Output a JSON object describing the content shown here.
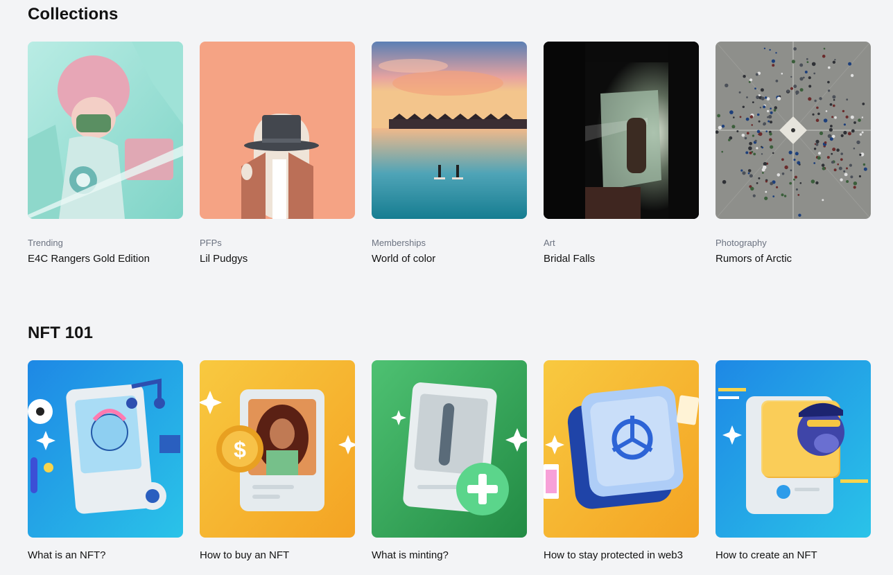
{
  "collections": {
    "title": "Collections",
    "items": [
      {
        "category": "Trending",
        "name": "E4C Rangers Gold Edition",
        "image": "anime-ranger-artwork"
      },
      {
        "category": "PFPs",
        "name": "Lil Pudgys",
        "image": "penguin-top-hat-artwork"
      },
      {
        "category": "Memberships",
        "name": "World of color",
        "image": "sunset-lagoon-photo"
      },
      {
        "category": "Art",
        "name": "Bridal Falls",
        "image": "dark-window-photo"
      },
      {
        "category": "Photography",
        "name": "Rumors of Arctic",
        "image": "aerial-crowd-photo"
      }
    ]
  },
  "nft101": {
    "title": "NFT 101",
    "items": [
      {
        "title": "What is an NFT?",
        "image": "nft-card-illustration"
      },
      {
        "title": "How to buy an NFT",
        "image": "buy-nft-coin-illustration"
      },
      {
        "title": "What is minting?",
        "image": "minting-plus-illustration"
      },
      {
        "title": "How to stay protected in web3",
        "image": "safe-vault-illustration"
      },
      {
        "title": "How to create an NFT",
        "image": "create-nft-ape-illustration"
      }
    ]
  },
  "colors": {
    "background": "#f3f4f6",
    "text": "#121212",
    "muted": "#6b7280"
  }
}
